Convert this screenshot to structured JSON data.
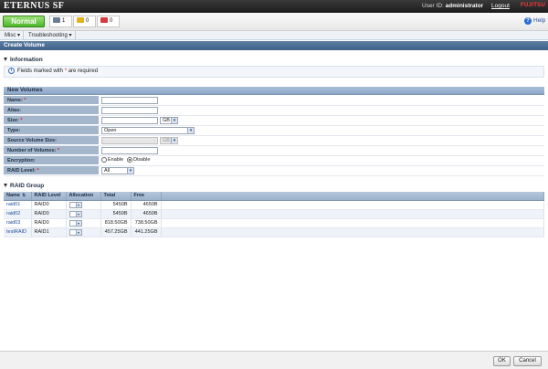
{
  "header": {
    "brand": "ETERNUS SF",
    "user_id_label": "User ID:",
    "user_id": "administrator",
    "logout": "Logout",
    "vendor": "FUJITSU"
  },
  "status": {
    "state": "Normal",
    "counts": [
      "1",
      "0",
      "0"
    ],
    "help": "Help"
  },
  "menu": {
    "items": [
      "Misc",
      "Troubleshooting"
    ]
  },
  "page_title": "Create Volume",
  "info": {
    "heading": "Information",
    "message_pre": "Fields marked with",
    "required_mark": "*",
    "message_post": "are required"
  },
  "new_volumes": {
    "heading": "New Volumes",
    "fields": {
      "name": {
        "label": "Name",
        "required": "*",
        "value": ""
      },
      "alias": {
        "label": "Alias",
        "value": ""
      },
      "size": {
        "label": "Size",
        "required": "*",
        "value": "",
        "unit": "GB"
      },
      "type": {
        "label": "Type",
        "value": "Open"
      },
      "source_size": {
        "label": "Source Volume Size",
        "value": "",
        "unit": "GB"
      },
      "number": {
        "label": "Number of Volumes",
        "required": "*",
        "value": ""
      },
      "encryption": {
        "label": "Encryption",
        "enable": "Enable",
        "disable": "Disable",
        "selected": "Disable"
      },
      "raid_level": {
        "label": "RAID Level",
        "required": "*",
        "value": "All"
      }
    }
  },
  "raid_group": {
    "heading": "RAID Group",
    "columns": [
      "Name",
      "RAID Level",
      "Allocation",
      "Total",
      "Free"
    ],
    "rows": [
      {
        "name": "raid01",
        "level": "RAID0",
        "total": "5450B",
        "free": "4650B"
      },
      {
        "name": "raid02",
        "level": "RAID0",
        "total": "5450B",
        "free": "4650B"
      },
      {
        "name": "raid03",
        "level": "RAID0",
        "total": "818.50GB",
        "free": "738.50GB"
      },
      {
        "name": "testRAID",
        "level": "RAID1",
        "total": "457.25GB",
        "free": "441.25GB"
      }
    ]
  },
  "footer": {
    "ok": "OK",
    "cancel": "Cancel"
  },
  "colors": {
    "title_bar": "#3f6088",
    "normal": "#4cb52a",
    "required": "#d92020"
  }
}
